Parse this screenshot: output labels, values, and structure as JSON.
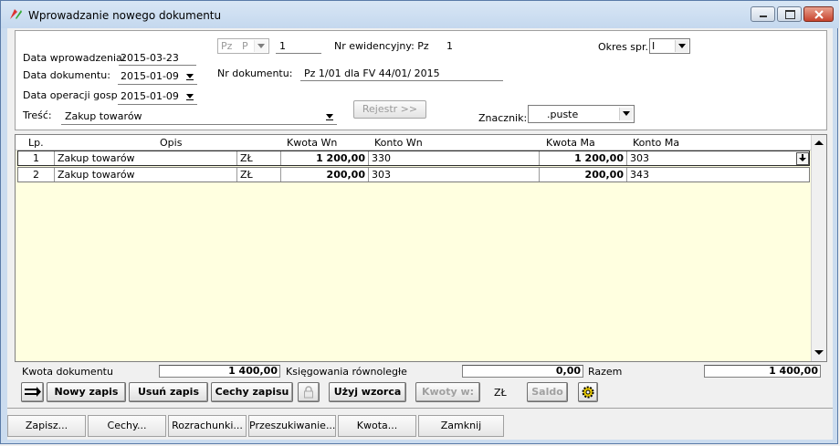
{
  "window": {
    "title": "Wprowadzanie nowego dokumentu"
  },
  "header": {
    "data_wprowadzenia_label": "Data wprowadzenia:",
    "data_wprowadzenia": "2015-03-23",
    "data_dokumentu_label": "Data dokumentu:",
    "data_dokumentu": "2015-01-09",
    "data_operacji_label": "Data operacji gosp.:",
    "data_operacji": "2015-01-09",
    "tresc_label": "Treść:",
    "tresc": "Zakup towarów",
    "typ1": "Pz",
    "typ2": "P",
    "numer": "1",
    "nr_ewid_label": "Nr ewidencyjny: Pz",
    "nr_ewid": "1",
    "okres_label": "Okres spr.",
    "okres": "I",
    "nr_dokumentu_label": "Nr dokumentu:",
    "nr_dokumentu": "Pz 1/01 dla FV 44/01/ 2015",
    "rejestr_button": "Rejestr >>",
    "znacznik_label": "Znacznik:",
    "znacznik": ".puste"
  },
  "grid": {
    "columns": [
      "Lp.",
      "Opis",
      "Kwota  Wn",
      "Konto  Wn",
      "Kwota Ma",
      "Konto Ma"
    ],
    "rows": [
      {
        "lp": "1",
        "opis": "Zakup towarów",
        "waluta": "ZŁ",
        "kwota_wn": "1 200,00",
        "konto_wn": "330",
        "kwota_ma": "1 200,00",
        "konto_ma": "303"
      },
      {
        "lp": "2",
        "opis": "Zakup towarów",
        "waluta": "ZŁ",
        "kwota_wn": "200,00",
        "konto_wn": "303",
        "kwota_ma": "200,00",
        "konto_ma": "343"
      }
    ]
  },
  "summary": {
    "kwota_dokumentu_label": "Kwota dokumentu",
    "kwota_dokumentu": "1 400,00",
    "ksiegowania_label": "Księgowania równoległe",
    "ksiegowania": "0,00",
    "razem_label": "Razem",
    "razem": "1 400,00"
  },
  "toolbar": {
    "nowy_zapis": "Nowy zapis",
    "usun_zapis": "Usuń zapis",
    "cechy_zapisu": "Cechy zapisu",
    "uzyj_wzorca": "Użyj wzorca",
    "kwoty_w": "Kwoty w:",
    "waluta": "ZŁ",
    "saldo": "Saldo"
  },
  "footer": {
    "zapisz": "Zapisz...",
    "cechy": "Cechy...",
    "rozrachunki": "Rozrachunki...",
    "przeszukiwanie": "Przeszukiwanie...",
    "kwota": "Kwota...",
    "zamknij": "Zamknij"
  }
}
